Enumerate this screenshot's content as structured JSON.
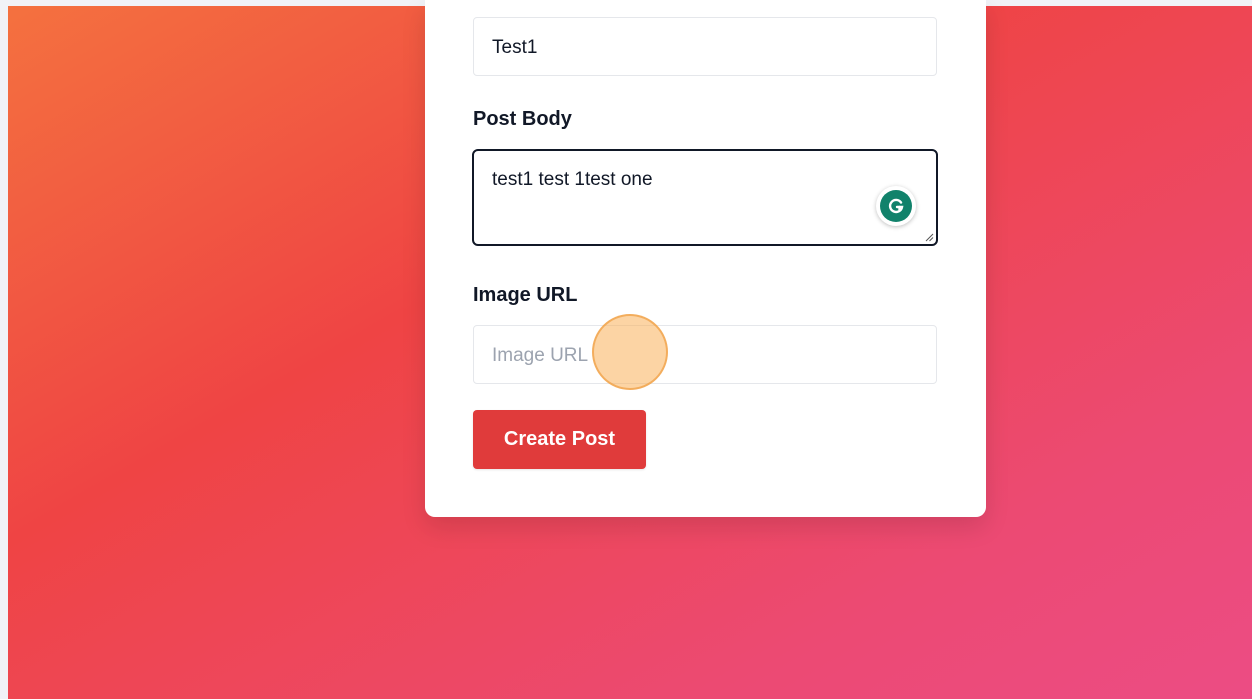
{
  "form": {
    "title_value": "Test1",
    "body_label": "Post Body",
    "body_value": "test1 test 1test one",
    "image_label": "Image URL",
    "image_placeholder": "Image URL",
    "submit_label": "Create Post"
  },
  "icons": {
    "grammarly": "grammarly-icon",
    "resize": "resize-handle-icon"
  },
  "colors": {
    "accent": "#e03b3b",
    "gradient_start": "#f4713f",
    "gradient_end": "#ec4c84",
    "grammarly": "#11826b"
  }
}
